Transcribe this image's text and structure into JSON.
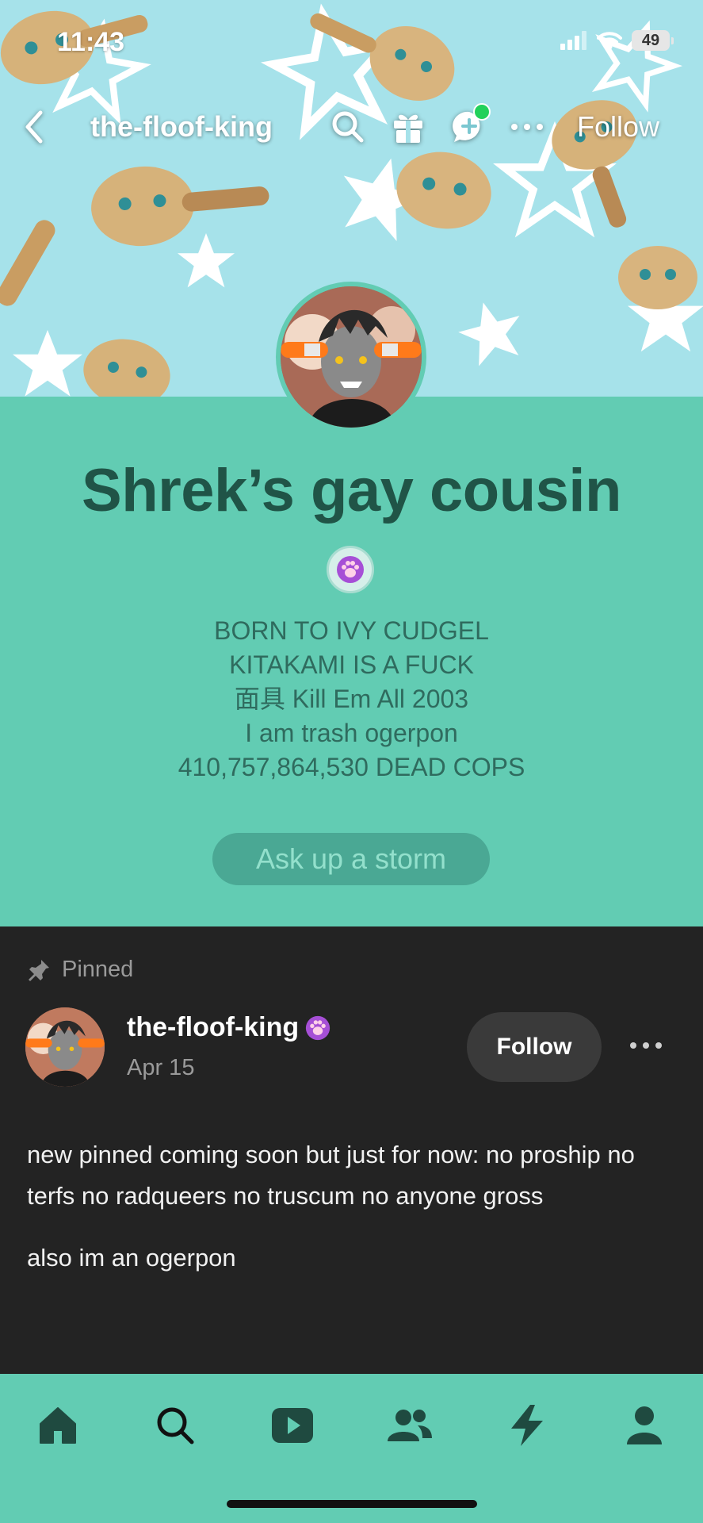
{
  "status_bar": {
    "time": "11:43",
    "battery": "49"
  },
  "navbar": {
    "back_icon": "chevron-left-icon",
    "username": "the-floof-king",
    "search_icon": "search-icon",
    "gift_icon": "gift-icon",
    "chat_icon": "chat-plus-icon",
    "more_icon": "more-horizontal-icon",
    "follow_label": "Follow"
  },
  "profile": {
    "title": "Shrek’s gay cousin",
    "badge_icon": "paw-badge-icon",
    "bio_lines": [
      "BORN TO IVY CUDGEL",
      "KITAKAMI IS A FUCK",
      "面具 Kill Em All 2003",
      "I am trash ogerpon",
      "410,757,864,530 DEAD COPS"
    ],
    "ask_label": "Ask up a storm"
  },
  "post": {
    "pinned_label": "Pinned",
    "pin_icon": "pin-icon",
    "author": "the-floof-king",
    "date": "Apr 15",
    "follow_label": "Follow",
    "more_icon": "more-horizontal-icon",
    "paragraphs": [
      "new pinned coming soon but just for now: no proship no terfs no radqueers no truscum no anyone gross",
      "also im an ogerpon"
    ]
  },
  "tabbar": {
    "items": [
      "home-icon",
      "search-icon",
      "play-icon",
      "community-icon",
      "activity-icon",
      "account-icon"
    ]
  },
  "colors": {
    "teal_background": "#62ccb3",
    "title_color": "#205447",
    "dark_background": "#232323",
    "tab_icon_color": "#1f4a40",
    "online_dot": "#22d15a"
  }
}
